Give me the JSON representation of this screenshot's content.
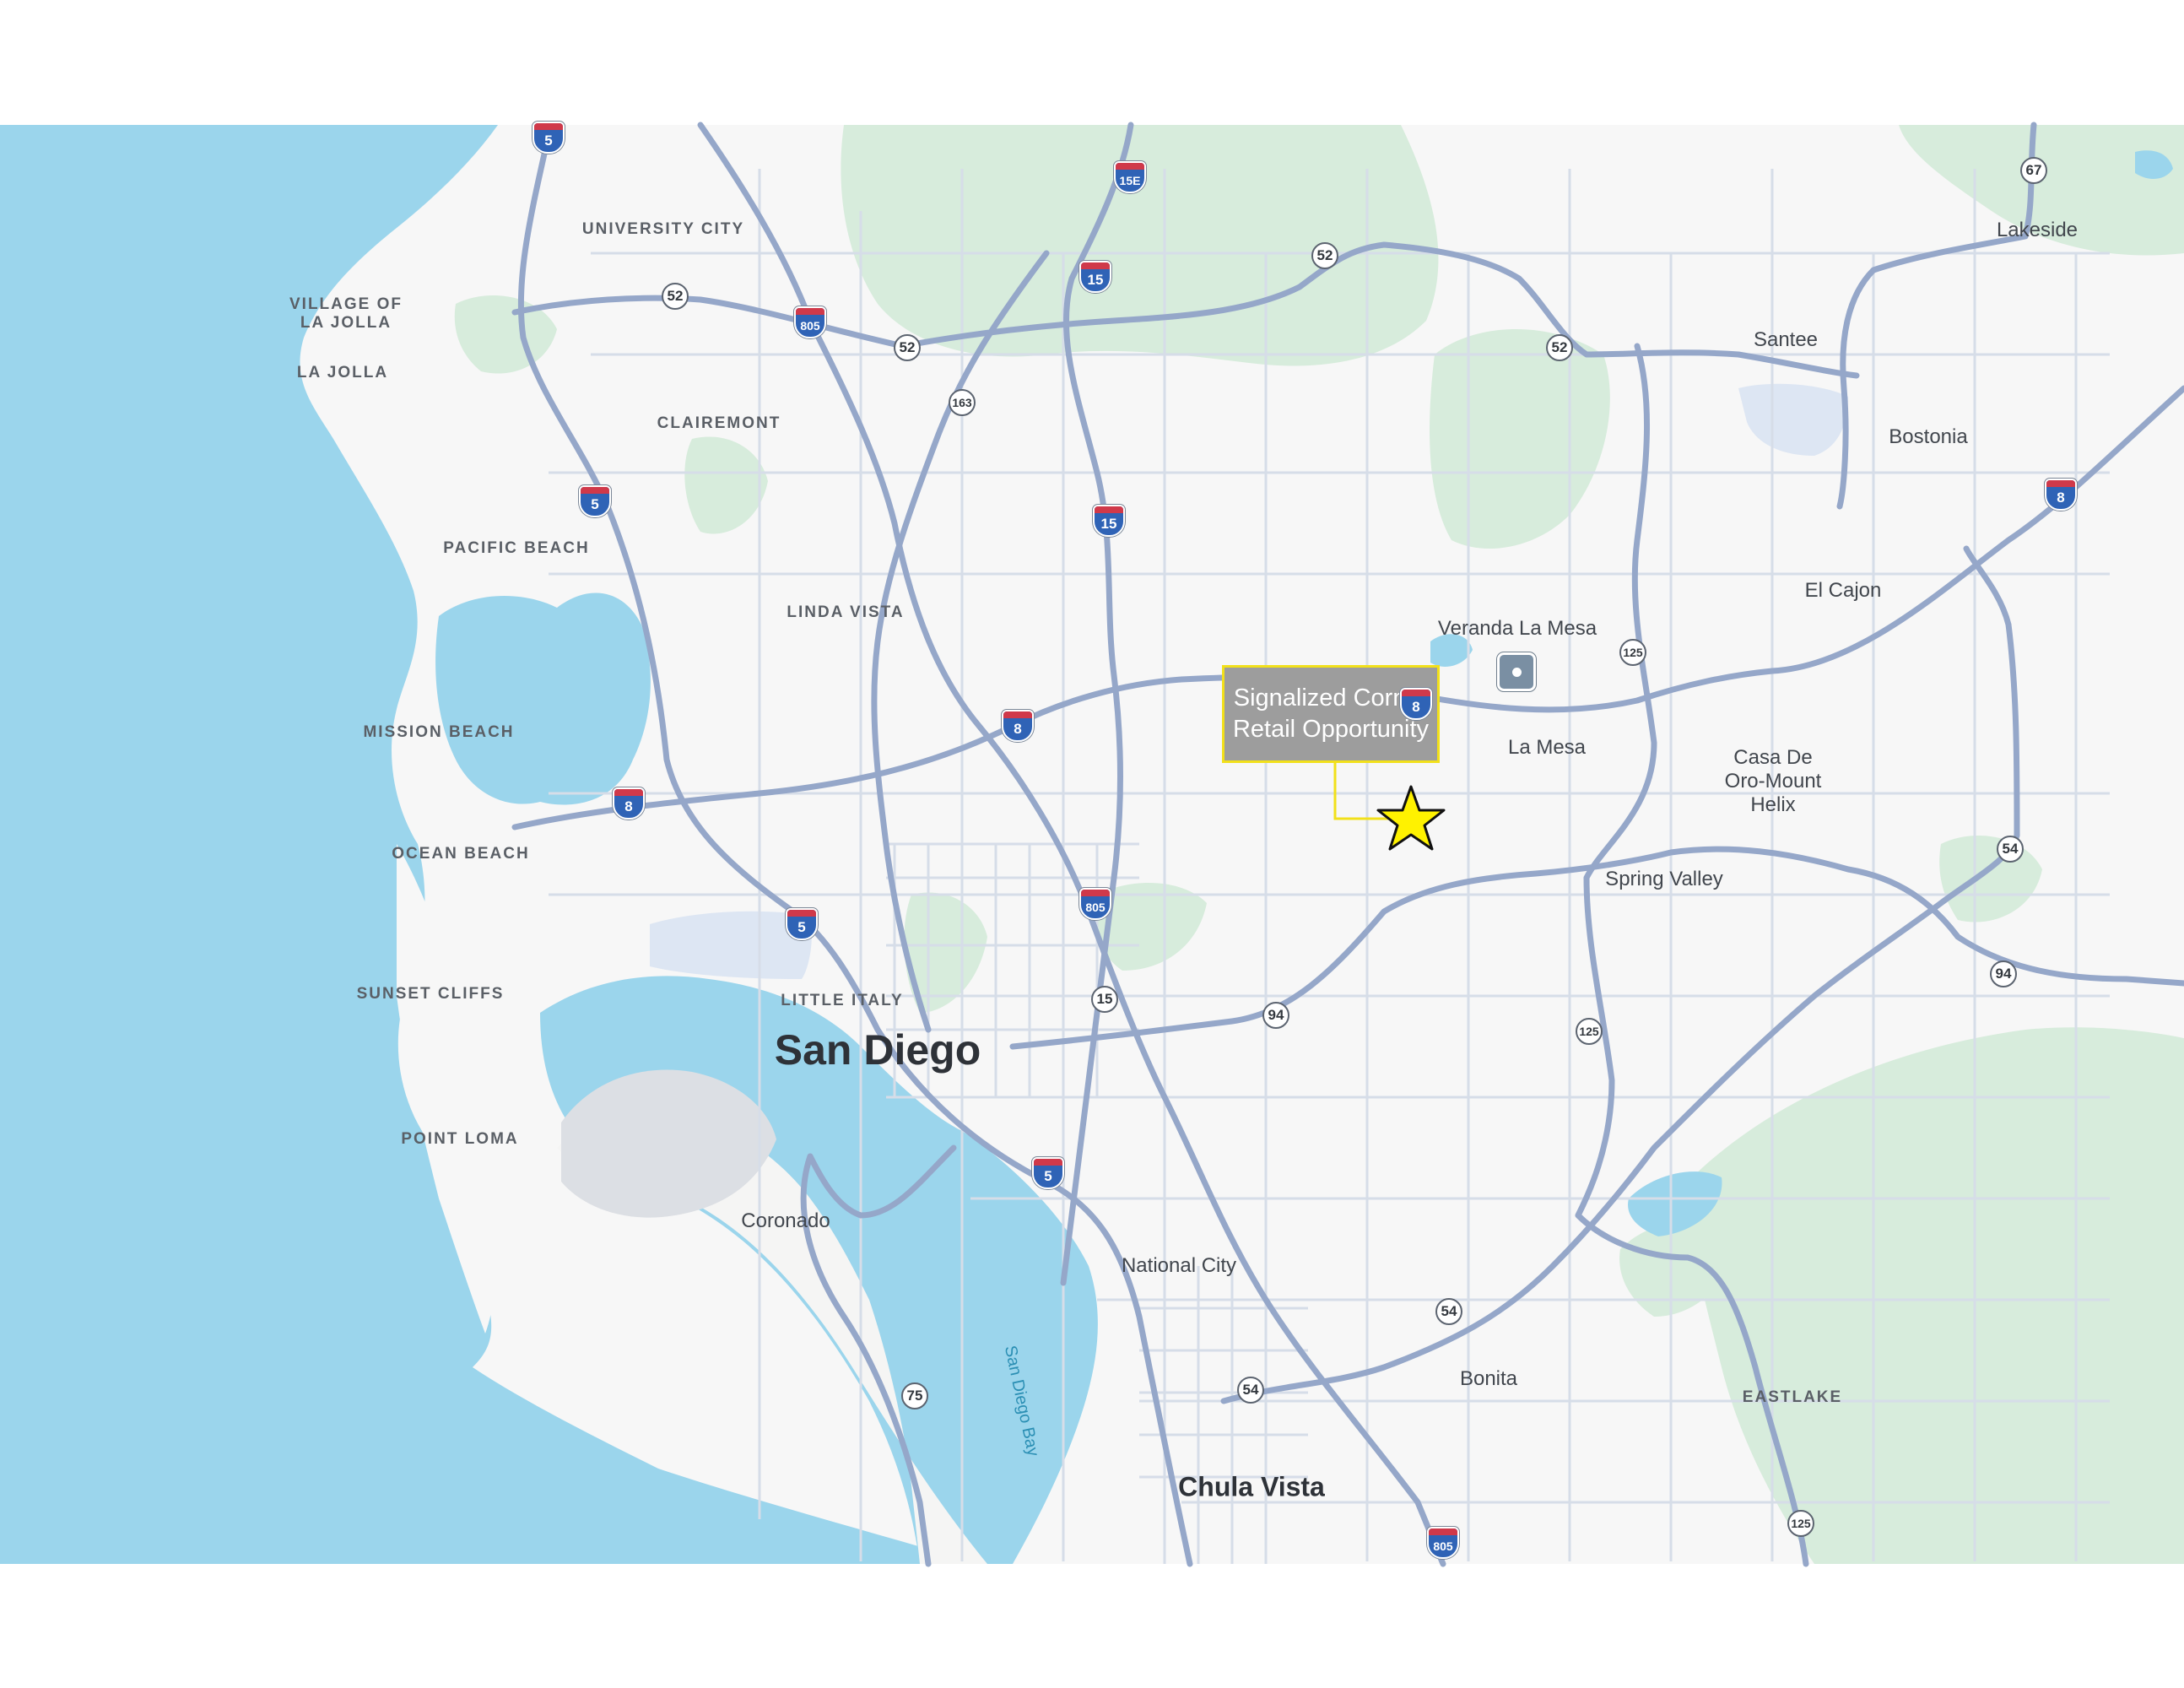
{
  "map": {
    "callout": {
      "text": "Signalized Corner Retail Opportunity",
      "border_color": "#f2e01a",
      "fill_color": "#9d9d9d"
    },
    "marker": {
      "icon": "star-icon",
      "fill": "#fff200",
      "stroke": "#111111"
    },
    "poi": {
      "icon": "landmark-poi-icon"
    },
    "colors": {
      "water": "#9bd5ec",
      "land": "#f7f7f7",
      "park": "#d7ecdc",
      "highway": "#95a7c9",
      "road": "#d3dbe6"
    },
    "places": [
      {
        "name": "UNIVERSITY CITY",
        "kind": "nb"
      },
      {
        "name": "VILLAGE OF\nLA JOLLA",
        "kind": "nb"
      },
      {
        "name": "LA JOLLA",
        "kind": "nb"
      },
      {
        "name": "CLAIREMONT",
        "kind": "nb"
      },
      {
        "name": "PACIFIC BEACH",
        "kind": "nb"
      },
      {
        "name": "LINDA VISTA",
        "kind": "nb"
      },
      {
        "name": "MISSION BEACH",
        "kind": "nb"
      },
      {
        "name": "OCEAN BEACH",
        "kind": "nb"
      },
      {
        "name": "SUNSET CLIFFS",
        "kind": "nb"
      },
      {
        "name": "POINT LOMA",
        "kind": "nb"
      },
      {
        "name": "LITTLE ITALY",
        "kind": "nb"
      },
      {
        "name": "EASTLAKE",
        "kind": "nb"
      },
      {
        "name": "San Diego",
        "kind": "metro"
      },
      {
        "name": "Chula Vista",
        "kind": "metro2"
      },
      {
        "name": "Coronado",
        "kind": "city"
      },
      {
        "name": "National City",
        "kind": "city"
      },
      {
        "name": "Bonita",
        "kind": "city"
      },
      {
        "name": "La Mesa",
        "kind": "city"
      },
      {
        "name": "Veranda La Mesa",
        "kind": "city"
      },
      {
        "name": "El Cajon",
        "kind": "city"
      },
      {
        "name": "Santee",
        "kind": "city"
      },
      {
        "name": "Lakeside",
        "kind": "city"
      },
      {
        "name": "Bostonia",
        "kind": "city"
      },
      {
        "name": "Casa De\nOro-Mount\nHelix",
        "kind": "city"
      },
      {
        "name": "Spring Valley",
        "kind": "city"
      },
      {
        "name": "San Diego Bay",
        "kind": "water"
      }
    ],
    "shields": [
      {
        "label": "5",
        "type": "interstate"
      },
      {
        "label": "15E",
        "type": "interstate"
      },
      {
        "label": "805",
        "type": "interstate"
      },
      {
        "label": "15",
        "type": "interstate"
      },
      {
        "label": "5",
        "type": "interstate"
      },
      {
        "label": "15",
        "type": "interstate"
      },
      {
        "label": "8",
        "type": "interstate"
      },
      {
        "label": "8",
        "type": "interstate"
      },
      {
        "label": "5",
        "type": "interstate"
      },
      {
        "label": "805",
        "type": "interstate"
      },
      {
        "label": "5",
        "type": "interstate"
      },
      {
        "label": "805",
        "type": "interstate"
      },
      {
        "label": "8",
        "type": "interstate"
      },
      {
        "label": "8",
        "type": "interstate"
      },
      {
        "label": "52",
        "type": "state"
      },
      {
        "label": "52",
        "type": "state"
      },
      {
        "label": "52",
        "type": "state"
      },
      {
        "label": "52",
        "type": "state"
      },
      {
        "label": "163",
        "type": "state"
      },
      {
        "label": "67",
        "type": "state"
      },
      {
        "label": "125",
        "type": "state"
      },
      {
        "label": "125",
        "type": "state"
      },
      {
        "label": "125",
        "type": "state"
      },
      {
        "label": "54",
        "type": "state"
      },
      {
        "label": "54",
        "type": "state"
      },
      {
        "label": "54",
        "type": "state"
      },
      {
        "label": "94",
        "type": "state"
      },
      {
        "label": "94",
        "type": "state"
      },
      {
        "label": "15",
        "type": "state"
      },
      {
        "label": "75",
        "type": "state"
      }
    ]
  }
}
